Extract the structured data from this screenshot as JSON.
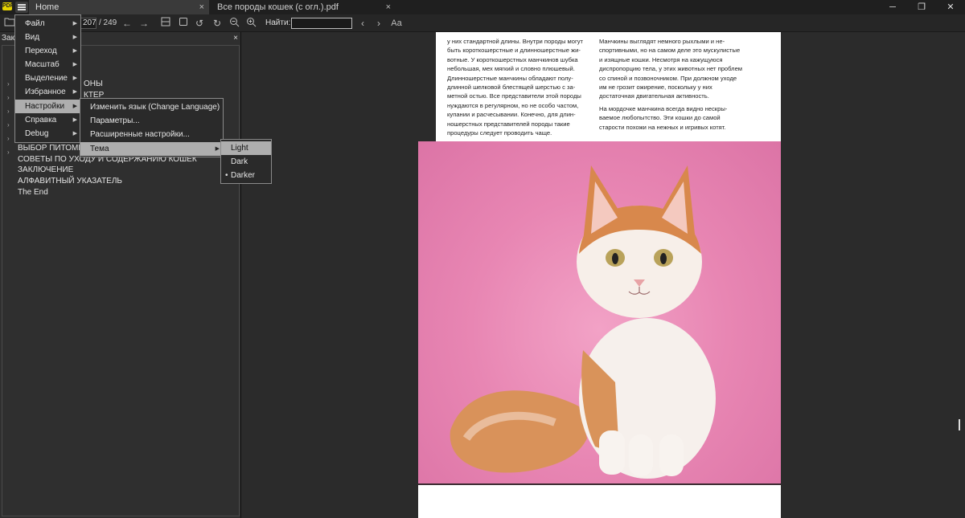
{
  "titlebar": {
    "logo_text": "PDF",
    "tabs": [
      {
        "label": "Home",
        "close": "×"
      },
      {
        "label": "Все породы кошек (с огл.).pdf",
        "close": "×"
      }
    ],
    "window_controls": {
      "minimize": "─",
      "maximize": "❐",
      "close": "✕"
    }
  },
  "toolbar": {
    "current_page": "207",
    "total_pages": "/ 249",
    "find_label": "Найти:",
    "find_value": "",
    "icons": [
      "folder-icon",
      "back-icon",
      "forward-icon",
      "fit-width-icon",
      "fit-page-icon",
      "rotate-left-icon",
      "rotate-right-icon",
      "zoom-out-icon",
      "zoom-in-icon",
      "find-prev-icon",
      "find-next-icon",
      "match-case-icon"
    ]
  },
  "sidebar": {
    "header": "Закл",
    "close": "×",
    "toc_fragments": [
      "ОНЫ",
      "КТЕР"
    ],
    "toc_items": [
      "ВЫБОР ПИТОМЦА",
      "СОВЕТЫ ПО УХОДУ И СОДЕРЖАНИЮ КОШЕК",
      "ЗАКЛЮЧЕНИЕ",
      "АЛФАВИТНЫЙ УКАЗАТЕЛЬ",
      "The End"
    ]
  },
  "main_menu": {
    "items": [
      {
        "label": "Файл"
      },
      {
        "label": "Вид"
      },
      {
        "label": "Переход"
      },
      {
        "label": "Масштаб"
      },
      {
        "label": "Выделение"
      },
      {
        "label": "Избранное"
      },
      {
        "label": "Настройки"
      },
      {
        "label": "Справка"
      },
      {
        "label": "Debug"
      }
    ]
  },
  "settings_menu": {
    "items": [
      {
        "label": "Изменить язык (Change Language)"
      },
      {
        "label": "Параметры..."
      },
      {
        "label": "Расширенные настройки..."
      },
      {
        "label": "Тема"
      }
    ]
  },
  "theme_menu": {
    "items": [
      {
        "label": "Light"
      },
      {
        "label": "Dark"
      },
      {
        "label": "Darker",
        "selected_mark": "•"
      }
    ]
  },
  "pdf": {
    "col1": [
      "у них стандартной длины. Внутри породы могут быть короткошерстные и длинношерстные жи­вотные. У короткошерстных манчкинов шубка небольшая, мех мягкий и словно плюшевый. Длинношерстные манчкины обладают полу­длинной шелковой блестящей шерстью с за­метной остью. Все представители этой породы нуждаются в регулярном, но не особо частом, купании и расчесывании. Конечно, для длин­ношерстных представителей породы такие процедуры следует проводить чаще."
    ],
    "col2": [
      "Манчкины выглядят немного рыхлыми и не­спортивными, но на самом деле это мускули­стые и изящные кошки. Несмотря на кажущу­юся диспропорцию тела, у этих животных нет проблем со спиной и позвоночником. При долж­ном уходе им не грозит ожирение, поскольку у них достаточная двигательная активность.",
      "На мордочке манчкина всегда видно нескры­ваемое любопытство. Эти кошки до самой старости похожи на нежных и игривых котят."
    ]
  }
}
